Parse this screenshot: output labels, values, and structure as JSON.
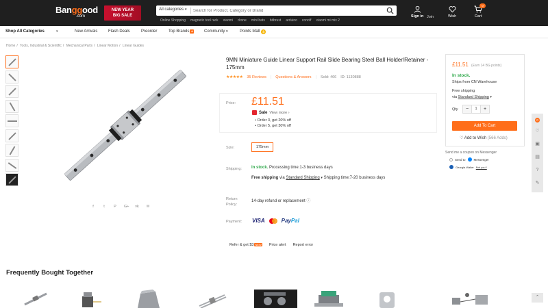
{
  "header": {
    "logo_main": "Ban",
    "logo_accent": "gg",
    "logo_tail": "ood",
    "logo_com": ".com",
    "promo_line1": "NEW YEAR",
    "promo_line2": "BIG SALE",
    "search_category": "All categories",
    "search_placeholder": "Search for Product, Category or Brand",
    "hot_tags": [
      "Online Shopping",
      "magnetic tool rack",
      "xiaomi",
      "drone",
      "mini bats",
      "bitbrust",
      "arduino",
      "conoff",
      "xiaomi mi mix 2"
    ],
    "signin": "Sign in",
    "join": "Join",
    "wish": "Wish",
    "cart": "Cart",
    "cart_count": "0"
  },
  "nav": {
    "all_categories": "Shop All Categories",
    "links": [
      "New Arrivals",
      "Flash Deals",
      "Preorder",
      "Top Brands",
      "Community",
      "Points Mall"
    ]
  },
  "breadcrumb": [
    "Home",
    "Tools, Industrial & Scientific",
    "Mechanical Parts",
    "Linear Motion",
    "Linear Guides"
  ],
  "product": {
    "title": "9MN Miniature Guide Linear Support Rail Slide Bearing Steel Ball Holder/Retainer - 175mm",
    "stars": "★★★★★",
    "reviews": "35 Reviews",
    "qa": "Questions & Answers",
    "sold": "Sold: 466",
    "id": "ID: 1130888",
    "price_label": "Price:",
    "price": "£11.51",
    "sale": "Sale",
    "view_more": "View more ›",
    "offers": [
      "Order 3, get 20% off",
      "Order 5, get 30% off"
    ],
    "size_label": "Size:",
    "size_value": "175mm",
    "shipping_label": "Shipping:",
    "in_stock": "In stock.",
    "processing": "Processing time:1-3 business days",
    "free_shipping": "Free shipping",
    "via": "via",
    "standard_shipping": "Standard Shipping",
    "shipping_time": "Shipping time:7-20 business days",
    "return_label": "Return Policy:",
    "return_text": "14-day refund or replacement",
    "payment_label": "Payment:",
    "visa": "VISA",
    "paypal_a": "Pay",
    "paypal_b": "Pal",
    "refer": "Refer & get $3",
    "new_badge": "NEW",
    "price_alert": "Price alert",
    "report_error": "Report error"
  },
  "social": [
    "f",
    "t",
    "P",
    "G+",
    "vk",
    "✉"
  ],
  "buybox": {
    "price": "£11.51",
    "points": "(Earn 14 BG points)",
    "in_stock": "In stock.",
    "ships_from": "Ships from CN Warehouse",
    "free_shipping": "Free shipping",
    "via": "via",
    "standard_shipping": "Standard Shipping",
    "qty_label": "Qty",
    "qty_value": "1",
    "add_to_cart": "Add To Cart",
    "add_to_wish": "Add to Wish",
    "wish_count": "(566 Adds)",
    "coupon_title": "Send me a coupon on Messenger",
    "send_to": "Send to",
    "messenger": "Messenger",
    "user_name": "Georgia Walter",
    "not_you": "Not you?"
  },
  "siderail": {
    "badge": "0"
  },
  "fbt": {
    "title": "Frequently Bought Together"
  },
  "colors": {
    "accent": "#ff6e1a",
    "header_bg": "#1f1f1f",
    "in_stock": "#2ea84a"
  }
}
